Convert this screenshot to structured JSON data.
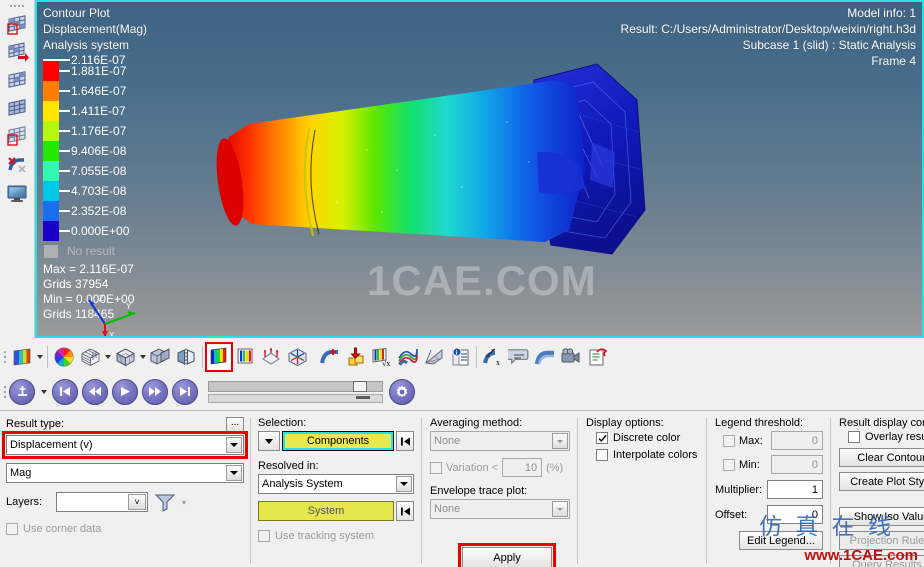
{
  "viewport": {
    "header_left": [
      "Contour Plot",
      "Displacement(Mag)",
      "Analysis system"
    ],
    "header_right": [
      "Model info: 1",
      "Result: C:/Users/Administrator/Desktop/weixin/right.h3d",
      "Subcase 1 (slid) : Static Analysis",
      "Frame 4"
    ],
    "watermark": "1CAE.COM",
    "legend": {
      "entries": [
        {
          "value": "2.116E-07",
          "color": "#ff0000"
        },
        {
          "value": "1.881E-07",
          "color": "#ff7e00"
        },
        {
          "value": "1.646E-07",
          "color": "#ffe400"
        },
        {
          "value": "1.411E-07",
          "color": "#b6f712"
        },
        {
          "value": "1.176E-07",
          "color": "#22e800"
        },
        {
          "value": "9.406E-08",
          "color": "#33f7b0"
        },
        {
          "value": "7.055E-08",
          "color": "#00c8e8"
        },
        {
          "value": "4.703E-08",
          "color": "#1a6ef0"
        },
        {
          "value": "2.352E-08",
          "color": "#1a00c8"
        },
        {
          "value": "0.000E+00",
          "color": "#ffffff"
        }
      ],
      "no_result_label": "No result",
      "no_result_color": "#b0b0b0",
      "stats": [
        "Max = 2.116E-07",
        "Grids 37954",
        "Min = 0.000E+00",
        "Grids 118465"
      ]
    },
    "triad": {
      "x_label": "X",
      "y_label": "Y",
      "z_label": "Z"
    }
  },
  "toolbar_icons": [
    {
      "name": "contour-plot-dropdown-icon",
      "label": "Contour"
    },
    {
      "name": "color-wheel-icon",
      "label": "Color"
    },
    {
      "name": "mesh-cube-icon",
      "label": "Mesh"
    },
    {
      "name": "solid-cube-icon",
      "label": "Solid"
    },
    {
      "name": "section-cut-icon",
      "label": "Section"
    },
    {
      "name": "mirror-icon",
      "label": "Mirror"
    },
    {
      "name": "contour-legend-icon",
      "label": "Contour",
      "highlighted": true
    },
    {
      "name": "iso-bands-icon",
      "label": "Iso"
    },
    {
      "name": "vector-plot-icon",
      "label": "Vector"
    },
    {
      "name": "tensor-plot-icon",
      "label": "Tensor"
    },
    {
      "name": "streamline-icon",
      "label": "Streamline"
    },
    {
      "name": "deformed-shape-icon",
      "label": "Deformed"
    },
    {
      "name": "load-export-icon",
      "label": "Export"
    },
    {
      "name": "math-contour-icon",
      "label": "Math"
    },
    {
      "name": "tracing-icon",
      "label": "Tracing"
    },
    {
      "name": "free-body-icon",
      "label": "Free Body"
    },
    {
      "name": "model-info-icon",
      "label": "Info"
    },
    {
      "name": "measure-icon",
      "label": "Measure"
    },
    {
      "name": "note-icon",
      "label": "Note"
    },
    {
      "name": "deformation-icon",
      "label": "Deformation"
    },
    {
      "name": "video-capture-icon",
      "label": "Capture"
    },
    {
      "name": "report-icon",
      "label": "Report"
    }
  ],
  "animation": {
    "mode_button": "animation-mode",
    "buttons": [
      "skip-start",
      "step-back",
      "play",
      "step-forward",
      "skip-end"
    ],
    "settings_button": "animation-settings",
    "slider_primary_pct": 88,
    "slider_secondary_pct": 90
  },
  "panel": {
    "result_type": {
      "label": "Result type:",
      "browse_button": "...",
      "value": "Displacement (v)",
      "component": "Mag",
      "layers_label": "Layers:",
      "layers_value": "",
      "filter_icon": "filter-icon",
      "use_corner_data_label": "Use corner data",
      "use_corner_data_checked": false
    },
    "selection": {
      "label": "Selection:",
      "entity_button": "Components",
      "reset_button": "reset-selection"
    },
    "resolved_in": {
      "label": "Resolved in:",
      "value": "Analysis System",
      "system_button": "System",
      "system_reset": "reset-system",
      "use_tracking_label": "Use tracking system",
      "use_tracking_checked": false
    },
    "averaging": {
      "label": "Averaging method:",
      "value": "None",
      "variation_label": "Variation <",
      "variation_checked": false,
      "variation_value": "10",
      "variation_unit": "(%)"
    },
    "envelope": {
      "label": "Envelope trace plot:",
      "value": "None"
    },
    "apply_button": "Apply",
    "display_options": {
      "label": "Display options:",
      "items": [
        {
          "label": "Discrete color",
          "checked": true
        },
        {
          "label": "Interpolate colors",
          "checked": false
        }
      ]
    },
    "legend_threshold": {
      "label": "Legend threshold:",
      "max_label": "Max:",
      "max_checked": false,
      "max_value": "0",
      "min_label": "Min:",
      "min_checked": false,
      "min_value": "0",
      "multiplier_label": "Multiplier:",
      "multiplier_value": "1",
      "offset_label": "Offset:",
      "offset_value": "0",
      "edit_legend_button": "Edit Legend..."
    },
    "result_display": {
      "label": "Result display control",
      "overlay_label": "Overlay result display",
      "overlay_checked": false,
      "buttons": [
        "Clear Contour",
        "Create Plot Style",
        "Show Iso Value",
        "Projection Rule...",
        "Query Results..."
      ]
    }
  },
  "overlay_watermark": {
    "cn_text": "仿 真 在 线",
    "url_text": "www.1CAE.com"
  },
  "colors": {
    "accent_cyan": "#21e4e4",
    "highlight_red": "#ee0000",
    "yellow_button": "#e6e64d",
    "panel_bg": "#f0f0f0"
  }
}
